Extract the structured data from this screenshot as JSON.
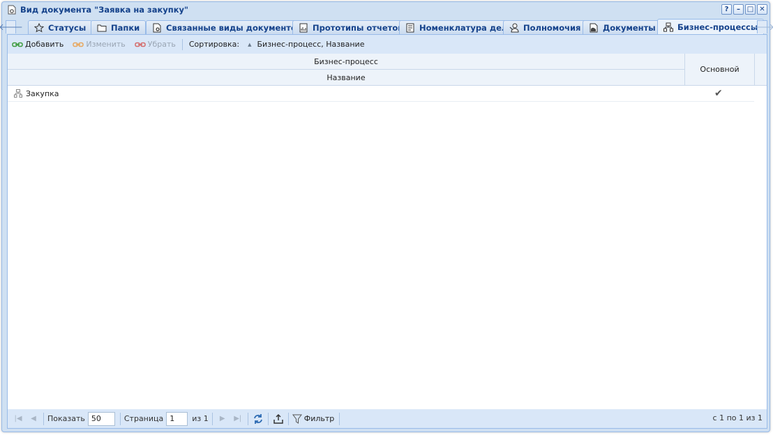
{
  "window": {
    "title": "Вид документа \"Заявка на закупку\"",
    "tools": {
      "help": "?",
      "minimize": "–",
      "maximize": "□",
      "close": "✕"
    }
  },
  "tabs": [
    {
      "label": "Статусы",
      "icon": "star-icon"
    },
    {
      "label": "Папки",
      "icon": "folder-icon"
    },
    {
      "label": "Связанные виды документов",
      "icon": "document-gear-icon"
    },
    {
      "label": "Прототипы отчетов",
      "icon": "report-icon"
    },
    {
      "label": "Номенклатура дел",
      "icon": "nomenclature-icon"
    },
    {
      "label": "Полномочия",
      "icon": "user-key-icon"
    },
    {
      "label": "Документы",
      "icon": "documents-icon"
    },
    {
      "label": "Бизнес-процессы",
      "icon": "process-icon",
      "active": true
    }
  ],
  "toolbar": {
    "add_label": "Добавить",
    "edit_label": "Изменить",
    "remove_label": "Убрать",
    "sort_label": "Сортировка:",
    "sort_value": "Бизнес-процесс, Название"
  },
  "grid": {
    "group_header": "Бизнес-процесс",
    "name_header": "Название",
    "main_header": "Основной",
    "rows": [
      {
        "name": "Закупка",
        "main": "✔"
      }
    ]
  },
  "pager": {
    "show_label": "Показать",
    "page_size": "50",
    "page_label": "Страница",
    "page": "1",
    "of_label": "из 1",
    "filter_label": "Фильтр",
    "info": "с 1 по 1 из 1"
  }
}
